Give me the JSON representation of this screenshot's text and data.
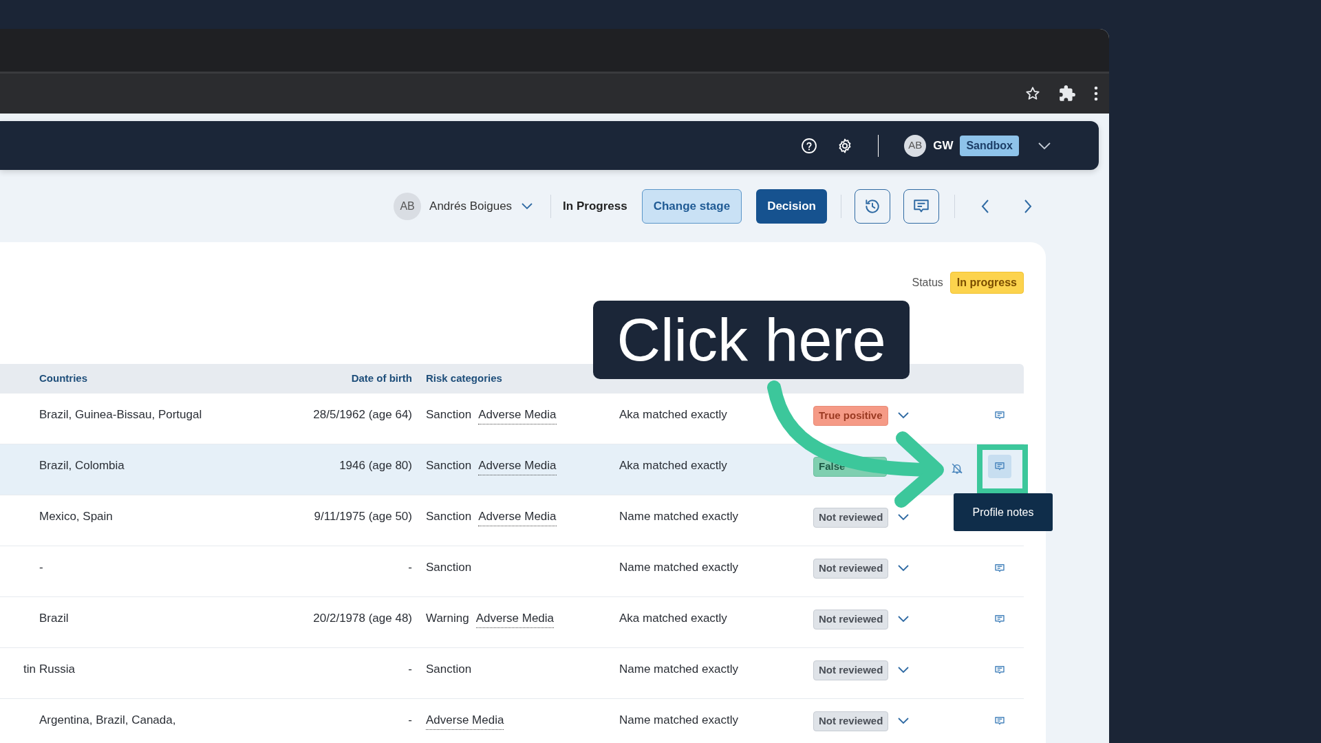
{
  "header": {
    "avatar": "AB",
    "user": "GW",
    "environment": "Sandbox"
  },
  "toolbar": {
    "assignee_avatar": "AB",
    "assignee": "Andrés Boigues",
    "stage": "In Progress",
    "buttons": [
      "Change stage",
      "Decision"
    ]
  },
  "case_status": {
    "label": "Status",
    "value": "In progress"
  },
  "table": {
    "columns": [
      "Countries",
      "Date of birth",
      "Risk categories"
    ],
    "rows": [
      {
        "selected": false,
        "countries": "Brazil, Guinea-Bissau, Portugal",
        "date_of_birth": "28/5/1962 (age 64)",
        "risk_categories": [
          {
            "kind": "plain",
            "label": "Sanction"
          },
          {
            "kind": "link",
            "label": "Adverse Media"
          }
        ],
        "relevance": "Aka matched exactly",
        "status": {
          "kind": "true-positive",
          "label": "True positive"
        },
        "notes": true
      },
      {
        "selected": true,
        "countries": "Brazil, Colombia",
        "date_of_birth": "1946 (age 80)",
        "risk_categories": [
          {
            "kind": "plain",
            "label": "Sanction"
          },
          {
            "kind": "link",
            "label": "Adverse Media"
          }
        ],
        "relevance": "Aka matched exactly",
        "status": {
          "kind": "false-positive",
          "label": "False"
        },
        "muted": true,
        "notes": true
      },
      {
        "selected": false,
        "countries": "Mexico, Spain",
        "date_of_birth": "9/11/1975 (age 50)",
        "risk_categories": [
          {
            "kind": "plain",
            "label": "Sanction"
          },
          {
            "kind": "link",
            "label": "Adverse Media"
          }
        ],
        "relevance": "Name matched exactly",
        "status": {
          "kind": "not-reviewed",
          "label": "Not reviewed"
        }
      },
      {
        "selected": false,
        "countries": "-",
        "date_of_birth": "-",
        "risk_categories": [
          {
            "kind": "plain",
            "label": "Sanction"
          }
        ],
        "relevance": "Name matched exactly",
        "status": {
          "kind": "not-reviewed",
          "label": "Not reviewed"
        },
        "notes": true
      },
      {
        "selected": false,
        "countries": "Brazil",
        "date_of_birth": "20/2/1978 (age 48)",
        "risk_categories": [
          {
            "kind": "plain",
            "label": "Warning"
          },
          {
            "kind": "link",
            "label": "Adverse Media"
          }
        ],
        "relevance": "Aka matched exactly",
        "status": {
          "kind": "not-reviewed",
          "label": "Not reviewed"
        },
        "notes": true
      },
      {
        "selected": false,
        "column_1": "tin",
        "countries": "Russia",
        "date_of_birth": "-",
        "risk_categories": [
          {
            "kind": "plain",
            "label": "Sanction"
          }
        ],
        "relevance": "Name matched exactly",
        "status": {
          "kind": "not-reviewed",
          "label": "Not reviewed"
        },
        "notes": true
      },
      {
        "selected": false,
        "countries": "Argentina, Brazil, Canada,",
        "date_of_birth": "-",
        "risk_categories": [
          {
            "kind": "link",
            "label": "Adverse Media"
          }
        ],
        "relevance": "Name matched exactly",
        "status": {
          "kind": "not-reviewed",
          "label": "Not reviewed"
        },
        "notes": true
      }
    ]
  },
  "callout": {
    "text": "Click here"
  },
  "tooltip": {
    "text": "Profile notes"
  }
}
